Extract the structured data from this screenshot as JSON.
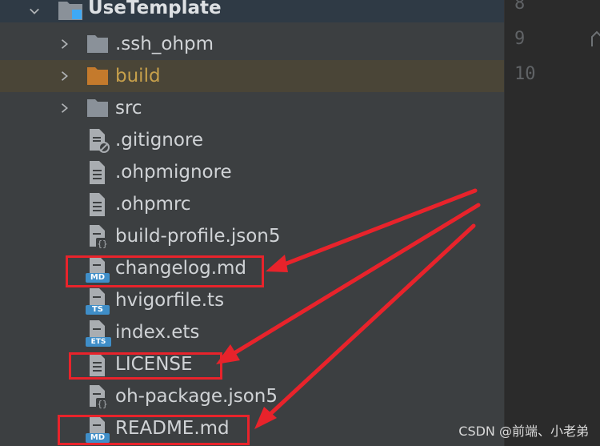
{
  "project": {
    "name": "UseTemplate",
    "expanded": true
  },
  "tree": {
    "folders": [
      {
        "label": ".ssh_ohpm",
        "icon": "folder-icon",
        "color": "#8a9199"
      },
      {
        "label": "build",
        "icon": "folder-icon",
        "color": "#c47a2c",
        "highlighted": true
      },
      {
        "label": "src",
        "icon": "folder-icon",
        "color": "#8a9199"
      }
    ],
    "files": [
      {
        "label": ".gitignore",
        "icon": "ignore-file-icon"
      },
      {
        "label": ".ohpmignore",
        "icon": "text-file-icon"
      },
      {
        "label": ".ohpmrc",
        "icon": "text-file-icon"
      },
      {
        "label": "build-profile.json5",
        "icon": "json-file-icon"
      },
      {
        "label": "changelog.md",
        "icon": "markdown-file-icon",
        "badge": "MD",
        "boxed": true
      },
      {
        "label": "hvigorfile.ts",
        "icon": "typescript-file-icon",
        "badge": "TS"
      },
      {
        "label": "index.ets",
        "icon": "ets-file-icon",
        "badge": "ETS"
      },
      {
        "label": "LICENSE",
        "icon": "text-file-icon",
        "boxed": true
      },
      {
        "label": "oh-package.json5",
        "icon": "json-file-icon"
      },
      {
        "label": "README.md",
        "icon": "markdown-file-icon",
        "badge": "MD",
        "boxed": true
      }
    ]
  },
  "editor": {
    "line_numbers": [
      "8",
      "9",
      "10"
    ]
  },
  "annotations": {
    "color": "#e8232b"
  },
  "watermark": "CSDN @前端、小老弟"
}
